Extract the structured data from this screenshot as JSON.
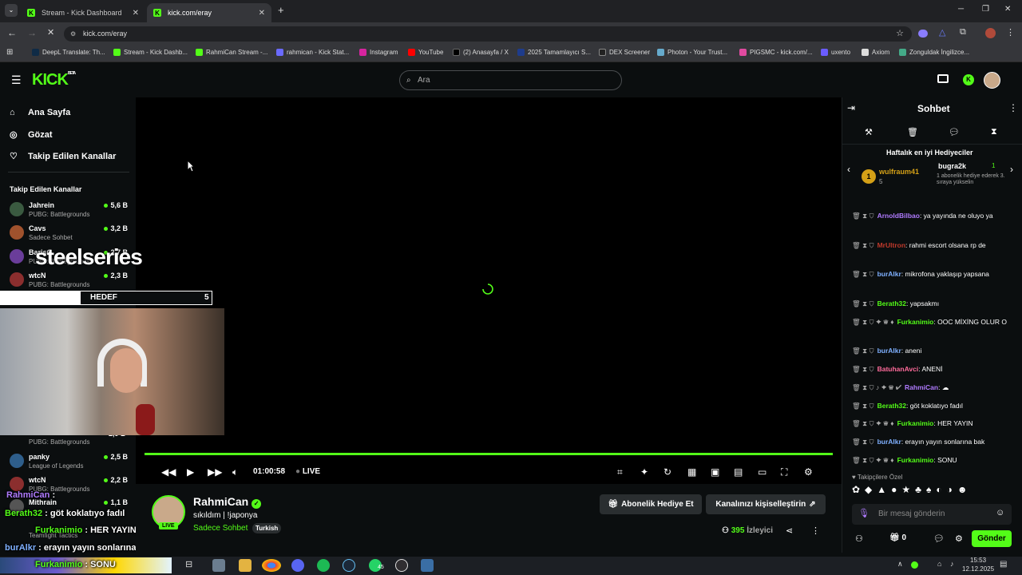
{
  "browser": {
    "tabs": [
      {
        "label": "Stream - Kick Dashboard",
        "active": false
      },
      {
        "label": "kick.com/eray",
        "active": true
      }
    ],
    "url": "kick.com/eray",
    "bookmarks": [
      "DeepL Translate: Th...",
      "Stream - Kick Dashb...",
      "RahmiCan Stream -...",
      "rahmican - Kick Stat...",
      "Instagram",
      "YouTube",
      "(2) Anasayfa / X",
      "2025 Tamamlayıcı S...",
      "DEX Screener",
      "Photon - Your Trust...",
      "PIGSMC - kick.com/...",
      "uxento",
      "Axiom",
      "Zonguldak İngilizce..."
    ]
  },
  "header": {
    "logo": "KICK",
    "logo_badge": "BETA",
    "search_placeholder": "Ara"
  },
  "sidebar": {
    "nav": [
      {
        "label": "Ana Sayfa",
        "icon": "home-icon"
      },
      {
        "label": "Gözat",
        "icon": "compass-icon"
      },
      {
        "label": "Takip Edilen Kanallar",
        "icon": "heart-icon"
      }
    ],
    "section_title": "Takip Edilen Kanallar",
    "channels": [
      {
        "name": "Jahrein",
        "game": "PUBG: Battlegrounds",
        "viewers": "5,6 B",
        "color": "#3a5a40"
      },
      {
        "name": "Cavs",
        "game": "Sadece Sohbet",
        "viewers": "3,2 B",
        "color": "#a0522d"
      },
      {
        "name": "BarişG",
        "game": "PUBG: Battlegrounds",
        "viewers": "2,7 B",
        "color": "#6a3d9a"
      },
      {
        "name": "wtcN",
        "game": "PUBG: Battlegrounds",
        "viewers": "2,3 B",
        "color": "#8b2e2e"
      },
      {
        "name": "panky",
        "game": "League of Legends",
        "viewers": "2,5 B",
        "color": "#2e5e8b"
      },
      {
        "name": "wtcN",
        "game": "PUBG: Battlegrounds",
        "viewers": "2,2 B",
        "color": "#8b2e2e"
      },
      {
        "name": "Mithrain",
        "game": "",
        "viewers": "1,1 B",
        "color": "#555"
      }
    ],
    "extra_viewers": "3,1 B",
    "extra_game_1": "PUBG: Battlegrounds",
    "extra_viewers_2": "2,9 B",
    "extra_game_2": "PUBG: Battlegrounds",
    "extra_game_3": "Teamfight Tactics"
  },
  "overlay": {
    "brand": "steelseries",
    "goal_label": "HEDEF",
    "goal_value": "5",
    "chat": [
      {
        "user": "RahmiCan",
        "text": " : ",
        "color": "#b07bff"
      },
      {
        "user": "Berath32",
        "text": " : göt koklatıyo fadıl",
        "color": "#53fc18"
      },
      {
        "user": "Furkanimio",
        "text": " : HER YAYIN",
        "color": "#53fc18"
      },
      {
        "user": "burAlkr",
        "text": " : erayın yayın sonlarına bak",
        "color": "#7fb0ff"
      },
      {
        "user": "Furkanimio",
        "text": " : SONU",
        "color": "#53fc18"
      }
    ]
  },
  "player": {
    "time": "01:00:58",
    "live_label": "LIVE"
  },
  "channel": {
    "name": "RahmiCan",
    "title": "sıkıldım | !japonya",
    "category": "Sadece Sohbet",
    "language": "Turkish",
    "live_badge": "LIVE",
    "gift_sub_button": "Abonelik Hediye Et",
    "customize_button": "Kanalınızı kişiselleştirin",
    "viewers": "395",
    "viewers_label": "İzleyici"
  },
  "chat": {
    "title": "Sohbet",
    "top_gifters_title": "Haftalık en iyi Hediyeciler",
    "gifter1_name": "wulfraum41",
    "gifter1_count": "5",
    "gifter1_rank": "1",
    "gifter2_name": "bugra2k",
    "gifter2_count": "1",
    "gifter2_note": "1 abonelik hediye ederek 3. sıraya yükselin",
    "messages": [
      {
        "user": "ArnoldBilbao",
        "color": "#b07bff",
        "text": ": ya yayında ne oluyo ya"
      },
      {
        "user": "MrUltron",
        "color": "#c0392b",
        "text": ": rahmi escort olsana rp de"
      },
      {
        "user": "burAlkr",
        "color": "#7fb0ff",
        "text": ": mikrofona yaklaşıp yapsana"
      },
      {
        "user": "Berath32",
        "color": "#53fc18",
        "text": ": yapsakmı"
      },
      {
        "user": "Furkanimio",
        "color": "#53fc18",
        "text": ": OOC MİXİNG OLUR O"
      },
      {
        "user": "burAlkr",
        "color": "#7fb0ff",
        "text": ": aneni"
      },
      {
        "user": "BatuhanAvci",
        "color": "#ff6b9b",
        "text": ": ANENİ"
      },
      {
        "user": "RahmiCan",
        "color": "#b07bff",
        "text": ":"
      },
      {
        "user": "Berath32",
        "color": "#53fc18",
        "text": ": göt koklatıyo fadıl"
      },
      {
        "user": "Furkanimio",
        "color": "#53fc18",
        "text": ": HER YAYIN"
      },
      {
        "user": "burAlkr",
        "color": "#7fb0ff",
        "text": ": erayın yayın sonlarına bak"
      },
      {
        "user": "Furkanimio",
        "color": "#53fc18",
        "text": ": SONU"
      }
    ],
    "emotes_label": "Takipçilere Özel",
    "input_placeholder": "Bir mesaj gönderin",
    "points": "0",
    "send_button": "Gönder"
  },
  "taskbar": {
    "time": "15:53",
    "date": "12.12.2025",
    "badge": "45"
  },
  "colors": {
    "accent": "#53fc18",
    "background": "#0b0e0f"
  }
}
